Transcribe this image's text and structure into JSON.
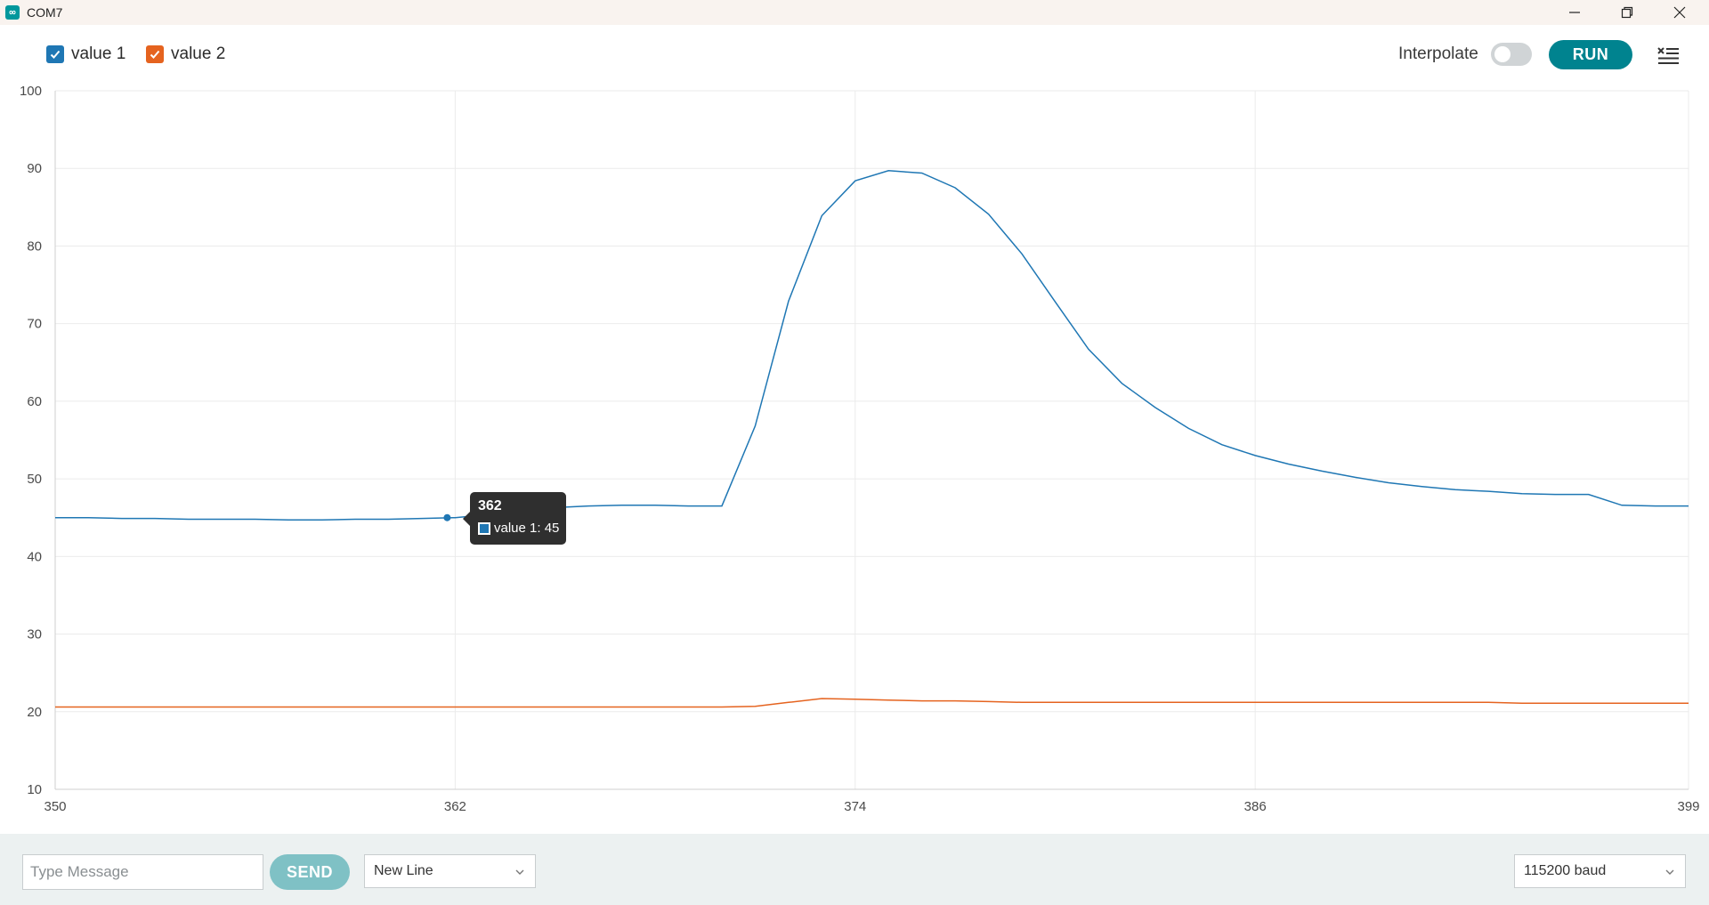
{
  "window": {
    "title": "COM7"
  },
  "toolbar": {
    "series_toggles": [
      {
        "label": "value 1",
        "color": "#1f77b4",
        "checked": true
      },
      {
        "label": "value 2",
        "color": "#e5631f",
        "checked": true
      }
    ],
    "interpolate_label": "Interpolate",
    "interpolate_on": false,
    "run_label": "RUN",
    "clear_icon": "clear-list-icon"
  },
  "chart_data": {
    "type": "line",
    "title": "",
    "xlabel": "",
    "ylabel": "",
    "xlim": [
      350,
      399
    ],
    "ylim": [
      10,
      100
    ],
    "xticks": [
      "350",
      "362",
      "374",
      "386",
      "399"
    ],
    "yticks": [
      "100",
      "90",
      "80",
      "70",
      "60",
      "50",
      "40",
      "30",
      "20",
      "10"
    ],
    "grid": true,
    "x": [
      350,
      351,
      352,
      353,
      354,
      355,
      356,
      357,
      358,
      359,
      360,
      361,
      362,
      363,
      364,
      365,
      366,
      367,
      368,
      369,
      370,
      371,
      372,
      373,
      374,
      375,
      376,
      377,
      378,
      379,
      380,
      381,
      382,
      383,
      384,
      385,
      386,
      387,
      388,
      389,
      390,
      391,
      392,
      393,
      394,
      395,
      396,
      397,
      398,
      399
    ],
    "series": [
      {
        "name": "value 1",
        "color": "#1f77b4",
        "values": [
          45.0,
          45.0,
          44.9,
          44.9,
          44.8,
          44.8,
          44.8,
          44.7,
          44.7,
          44.8,
          44.8,
          44.9,
          45.0,
          45.4,
          45.9,
          46.3,
          46.5,
          46.6,
          46.6,
          46.5,
          46.5,
          56.8,
          72.9,
          83.9,
          88.4,
          89.7,
          89.4,
          87.5,
          84.1,
          79.0,
          72.8,
          66.7,
          62.3,
          59.2,
          56.5,
          54.4,
          53.0,
          51.9,
          51.0,
          50.2,
          49.5,
          49.0,
          48.6,
          48.4,
          48.1,
          48.0,
          48.0,
          46.6,
          46.5,
          46.5
        ]
      },
      {
        "name": "value 2",
        "color": "#e5631f",
        "values": [
          20.6,
          20.6,
          20.6,
          20.6,
          20.6,
          20.6,
          20.6,
          20.6,
          20.6,
          20.6,
          20.6,
          20.6,
          20.6,
          20.6,
          20.6,
          20.6,
          20.6,
          20.6,
          20.6,
          20.6,
          20.6,
          20.7,
          21.2,
          21.7,
          21.6,
          21.5,
          21.4,
          21.4,
          21.3,
          21.2,
          21.2,
          21.2,
          21.2,
          21.2,
          21.2,
          21.2,
          21.2,
          21.2,
          21.2,
          21.2,
          21.2,
          21.2,
          21.2,
          21.2,
          21.1,
          21.1,
          21.1,
          21.1,
          21.1,
          21.1
        ]
      }
    ]
  },
  "tooltip": {
    "x_value": 362,
    "title": "362",
    "series_label": "value 1: 45",
    "series_value": 45,
    "color": "#1f77b4"
  },
  "bottom": {
    "message_placeholder": "Type Message",
    "send_label": "SEND",
    "line_ending": "New Line",
    "baud": "115200 baud"
  }
}
